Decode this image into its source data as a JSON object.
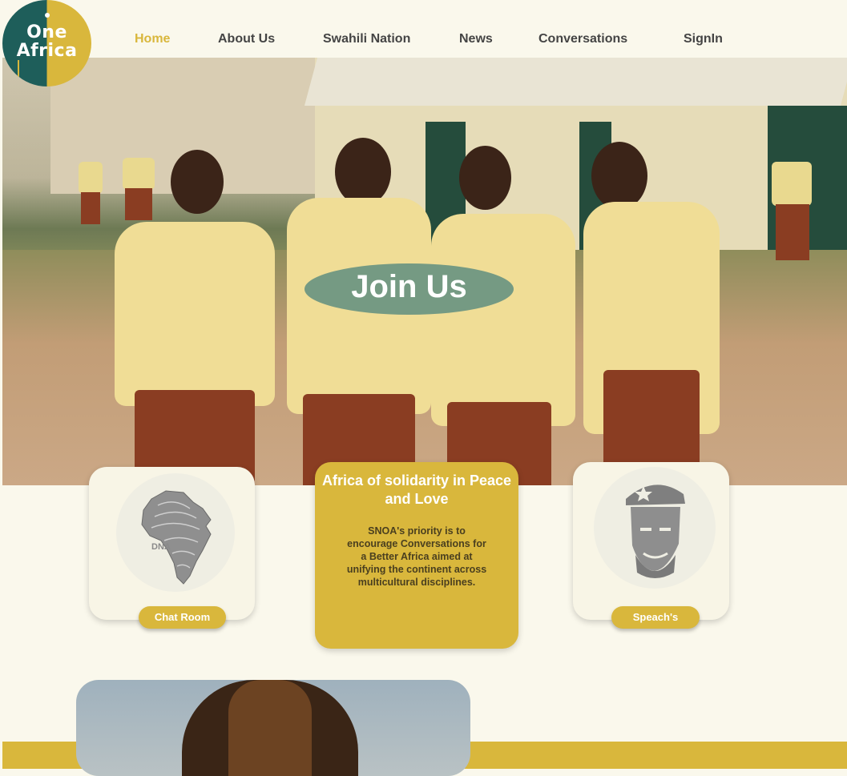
{
  "logo": {
    "line1": "One",
    "line2": "Africa"
  },
  "nav": {
    "items": [
      {
        "label": "Home",
        "active": true
      },
      {
        "label": "About Us"
      },
      {
        "label": "Swahili Nation"
      },
      {
        "label": "News"
      },
      {
        "label": "Conversations"
      },
      {
        "label": "SignIn"
      }
    ]
  },
  "hero": {
    "cta_label": "Join Us"
  },
  "cards": {
    "left": {
      "badge_text": "DNA",
      "button_label": "Chat Room"
    },
    "middle": {
      "title": "Africa of solidarity in Peace and Love",
      "body": "SNOA's priority is to encourage Conversations for a Better Africa aimed at unifying the continent across multicultural disciplines."
    },
    "right": {
      "button_label": "Speach's"
    }
  },
  "colors": {
    "accent": "#d9b73c",
    "teal": "#1e5e5a",
    "background": "#faf8ec"
  }
}
